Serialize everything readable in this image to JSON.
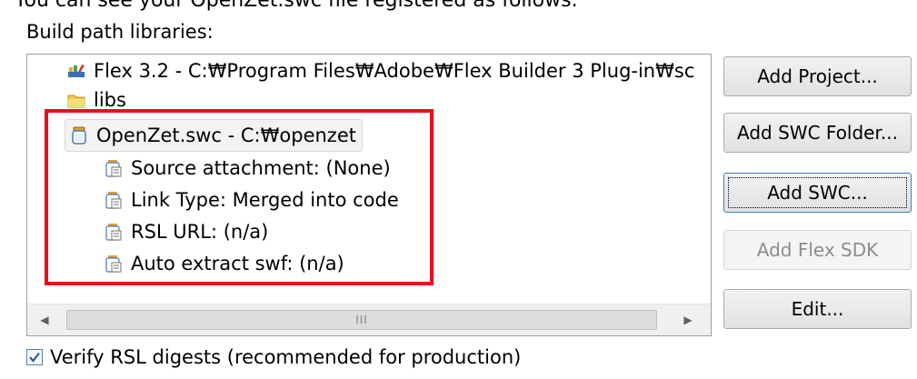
{
  "caption": "You can see your OpenZet.swc file registered as follows.",
  "section_label": "Build path libraries:",
  "tree": {
    "items": [
      {
        "label": "Flex 3.2 - C:₩Program Files₩Adobe₩Flex Builder 3 Plug-in₩sc",
        "icon": "library-icon"
      },
      {
        "label": "libs",
        "icon": "folder-icon"
      },
      {
        "label": "OpenZet.swc - C:₩openzet",
        "icon": "swc-jar-icon"
      },
      {
        "label": "Source attachment: (None)",
        "icon": "attribute-icon"
      },
      {
        "label": "Link Type: Merged into code",
        "icon": "attribute-icon"
      },
      {
        "label": "RSL URL: (n/a)",
        "icon": "attribute-icon"
      },
      {
        "label": "Auto extract swf: (n/a)",
        "icon": "attribute-icon"
      }
    ],
    "scroll_thumb_grip": "III"
  },
  "buttons": {
    "add_project": "Add Project...",
    "add_swc_folder": "Add SWC Folder...",
    "add_swc": "Add SWC...",
    "add_flex_sdk": "Add Flex SDK",
    "edit": "Edit..."
  },
  "checkbox": {
    "label": "Verify RSL digests (recommended for production)",
    "checked": true
  },
  "colors": {
    "highlight": "#e8101a",
    "checkmark": "#2a5fa0"
  }
}
